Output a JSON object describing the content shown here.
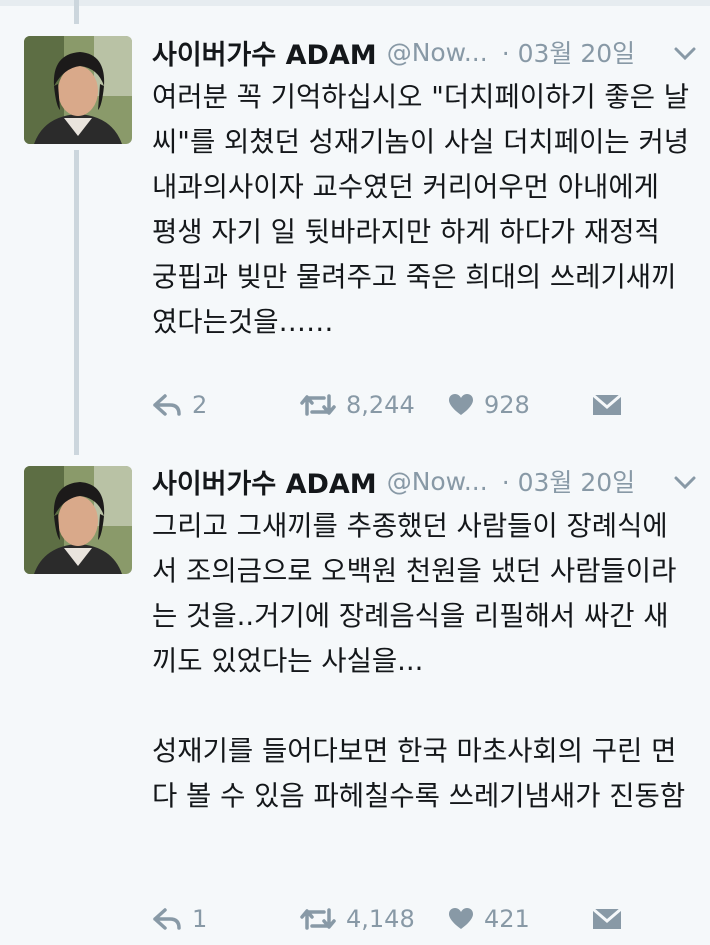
{
  "tweets": [
    {
      "name": "사이버가수 ADAM",
      "handle": "@Now...",
      "date": "· 03월 20일",
      "text": "여러분 꼭 기억하십시오 \"더치페이하기 좋은 날씨\"를 외쳤던 성재기놈이 사실 더치페이는 커녕  내과의사이자 교수였던 커리어우먼 아내에게 평생 자기 일 뒷바라지만 하게 하다가 재정적 궁핍과 빚만 물려주고 죽은 희대의 쓰레기새끼였다는것을……",
      "replies": "2",
      "retweets": "8,244",
      "likes": "928"
    },
    {
      "name": "사이버가수 ADAM",
      "handle": "@Now...",
      "date": "· 03월 20일",
      "text": "그리고 그새끼를 추종했던 사람들이 장례식에서 조의금으로 오백원 천원을 냈던 사람들이라는 것을..거기에 장례음식을 리필해서 싸간 새끼도 있었다는 사실을...\n\n성재기를 들어다보면 한국 마초사회의 구린 면 다 볼 수 있음 파헤칠수록 쓰레기냄새가 진동함",
      "replies": "1",
      "retweets": "4,148",
      "likes": "421"
    }
  ],
  "icons": {
    "reply": "reply-icon",
    "retweet": "retweet-icon",
    "like": "heart-icon",
    "dm": "envelope-icon",
    "more": "chevron-down-icon"
  },
  "colors": {
    "background": "#f5f8fa",
    "text": "#14171a",
    "muted": "#8899a6",
    "thread_line": "#ccd6dd"
  }
}
